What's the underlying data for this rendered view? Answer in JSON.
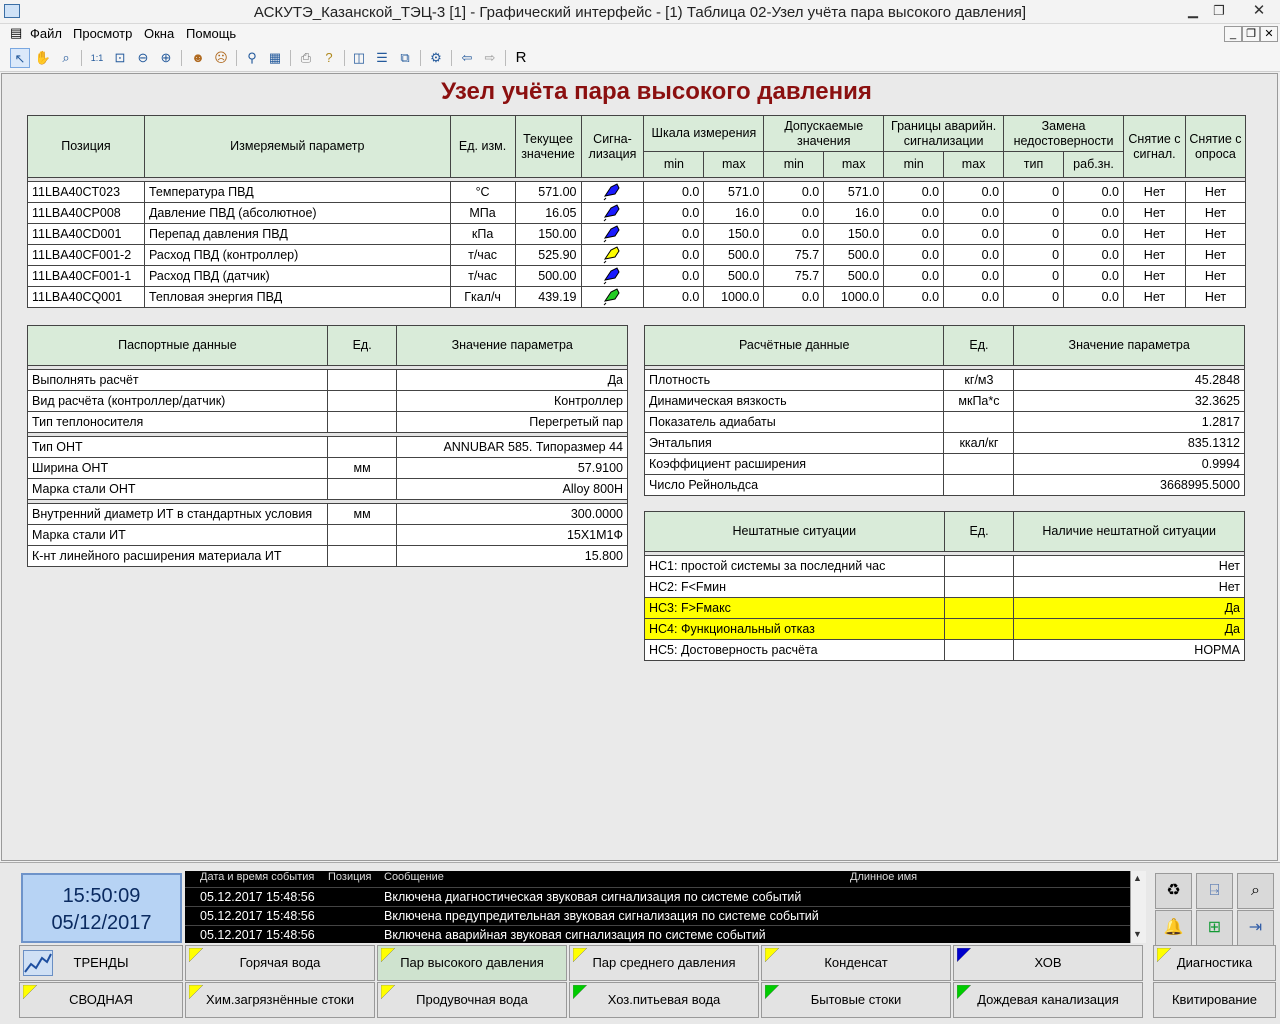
{
  "window": {
    "title": "АСКУТЭ_Казанской_ТЭЦ-3 [1] - Графический интерфейс - [1) Таблица 02-Узел учёта пара высокого давления]"
  },
  "menu": [
    "Файл",
    "Просмотр",
    "Окна",
    "Помощь"
  ],
  "toolbar": {
    "r_label": "R"
  },
  "page_title": "Узел учёта пара высокого давления",
  "main_table": {
    "headers": {
      "position": "Позиция",
      "parameter": "Измеряемый параметр",
      "unit": "Ед. изм.",
      "current": "Текущее значение",
      "signal": "Сигна-лизация",
      "scale": "Шкала измерения",
      "allowed": "Допускаемые значения",
      "emergency": "Границы аварийн. сигнализации",
      "replace": "Замена недостоверности",
      "remove_sig": "Снятие с сигнал.",
      "remove_poll": "Снятие с опроса",
      "min": "min",
      "max": "max",
      "type": "тип",
      "work": "раб.зн."
    },
    "rows": [
      {
        "pos": "11LBA40CT023",
        "name": "Температура ПВД",
        "unit": "°С",
        "value": "571.00",
        "signal_color": "#1a1aff",
        "smin": "0.0",
        "smax": "571.0",
        "amin": "0.0",
        "amax": "571.0",
        "emin": "0.0",
        "emax": "0.0",
        "rtype": "0",
        "rval": "0.0",
        "rsig": "Нет",
        "rpoll": "Нет"
      },
      {
        "pos": "11LBA40CP008",
        "name": "Давление ПВД (абсолютное)",
        "unit": "МПа",
        "value": "16.05",
        "signal_color": "#1a1aff",
        "smin": "0.0",
        "smax": "16.0",
        "amin": "0.0",
        "amax": "16.0",
        "emin": "0.0",
        "emax": "0.0",
        "rtype": "0",
        "rval": "0.0",
        "rsig": "Нет",
        "rpoll": "Нет"
      },
      {
        "pos": "11LBA40CD001",
        "name": "Перепад давления ПВД",
        "unit": "кПа",
        "value": "150.00",
        "signal_color": "#1a1aff",
        "smin": "0.0",
        "smax": "150.0",
        "amin": "0.0",
        "amax": "150.0",
        "emin": "0.0",
        "emax": "0.0",
        "rtype": "0",
        "rval": "0.0",
        "rsig": "Нет",
        "rpoll": "Нет"
      },
      {
        "pos": "11LBA40CF001-2",
        "name": "Расход ПВД (контроллер)",
        "unit": "т/час",
        "value": "525.90",
        "signal_color": "#ffff00",
        "smin": "0.0",
        "smax": "500.0",
        "amin": "75.7",
        "amax": "500.0",
        "emin": "0.0",
        "emax": "0.0",
        "rtype": "0",
        "rval": "0.0",
        "rsig": "Нет",
        "rpoll": "Нет"
      },
      {
        "pos": "11LBA40CF001-1",
        "name": "Расход ПВД (датчик)",
        "unit": "т/час",
        "value": "500.00",
        "signal_color": "#1a1aff",
        "smin": "0.0",
        "smax": "500.0",
        "amin": "75.7",
        "amax": "500.0",
        "emin": "0.0",
        "emax": "0.0",
        "rtype": "0",
        "rval": "0.0",
        "rsig": "Нет",
        "rpoll": "Нет"
      },
      {
        "pos": "11LBA40CQ001",
        "name": "Тепловая энергия ПВД",
        "unit": "Гкал/ч",
        "value": "439.19",
        "signal_color": "#22cc22",
        "smin": "0.0",
        "smax": "1000.0",
        "amin": "0.0",
        "amax": "1000.0",
        "emin": "0.0",
        "emax": "0.0",
        "rtype": "0",
        "rval": "0.0",
        "rsig": "Нет",
        "rpoll": "Нет"
      }
    ]
  },
  "passport": {
    "headers": {
      "name": "Паспортные данные",
      "unit": "Ед.",
      "value": "Значение параметра"
    },
    "rows": [
      {
        "name": "Выполнять расчёт",
        "unit": "",
        "value": "Да"
      },
      {
        "name": "Вид расчёта (контроллер/датчик)",
        "unit": "",
        "value": "Контроллер"
      },
      {
        "name": "Тип теплоносителя",
        "unit": "",
        "value": "Перегретый пар"
      },
      {
        "name": "Тип ОНТ",
        "unit": "",
        "value": "ANNUBAR 585. Типоразмер 44"
      },
      {
        "name": "Ширина ОНТ",
        "unit": "мм",
        "value": "57.9100"
      },
      {
        "name": "Марка стали ОНТ",
        "unit": "",
        "value": "Alloy 800H"
      },
      {
        "name": "Внутренний диаметр ИТ в стандартных условия",
        "unit": "мм",
        "value": "300.0000"
      },
      {
        "name": "Марка стали ИТ",
        "unit": "",
        "value": "15Х1М1Ф"
      },
      {
        "name": "К-нт линейного расширения материала ИТ",
        "unit": "",
        "value": "15.800"
      }
    ]
  },
  "calc": {
    "headers": {
      "name": "Расчётные данные",
      "unit": "Ед.",
      "value": "Значение параметра"
    },
    "rows": [
      {
        "name": "Плотность",
        "unit": "кг/м3",
        "value": "45.2848"
      },
      {
        "name": "Динамическая вязкость",
        "unit": "мкПа*с",
        "value": "32.3625"
      },
      {
        "name": "Показатель адиабаты",
        "unit": "",
        "value": "1.2817"
      },
      {
        "name": "Энтальпия",
        "unit": "ккал/кг",
        "value": "835.1312"
      },
      {
        "name": "Коэффициент расширения",
        "unit": "",
        "value": "0.9994"
      },
      {
        "name": "Число Рейнольдса",
        "unit": "",
        "value": "3668995.5000"
      }
    ]
  },
  "abnormal": {
    "headers": {
      "name": "Нештатные ситуации",
      "unit": "Ед.",
      "value": "Наличие нештатной ситуации"
    },
    "rows": [
      {
        "name": "НС1: простой системы за последний час",
        "unit": "",
        "value": "Нет"
      },
      {
        "name": "НС2: F<Fмин",
        "unit": "",
        "value": "Нет"
      },
      {
        "name": "НС3: F>Fмакс",
        "unit": "",
        "value": "Да"
      },
      {
        "name": "НС4: Функциональный отказ",
        "unit": "",
        "value": "Да"
      },
      {
        "name": "НС5: Достоверность расчёта",
        "unit": "",
        "value": "НОРМА"
      }
    ]
  },
  "clock": {
    "time": "15:50:09",
    "date": "05/12/2017"
  },
  "events": {
    "headers": {
      "datetime": "Дата и время события",
      "position": "Позиция",
      "message": "Сообщение",
      "longname": "Длинное имя"
    },
    "rows": [
      {
        "datetime": "05.12.2017 15:48:56",
        "position": "",
        "message": "Включена диагностическая звуковая сигнализация по системе событий",
        "longname": ""
      },
      {
        "datetime": "05.12.2017 15:48:56",
        "position": "",
        "message": "Включена предупредительная звуковая сигнализация по системе событий",
        "longname": ""
      },
      {
        "datetime": "05.12.2017 15:48:56",
        "position": "",
        "message": "Включена аварийная звуковая сигнализация по системе событий",
        "longname": ""
      }
    ]
  },
  "nav": {
    "trends": "ТРЕНДЫ",
    "summary": "СВОДНАЯ",
    "row1": [
      {
        "label": "Горячая вода",
        "flag": "#ffff00"
      },
      {
        "label": "Пар высокого давления",
        "flag": "#ffff00"
      },
      {
        "label": "Пар среднего давления",
        "flag": "#ffff00"
      },
      {
        "label": "Конденсат",
        "flag": "#ffff00"
      },
      {
        "label": "ХОВ",
        "flag": "#0000cc"
      }
    ],
    "row2": [
      {
        "label": "Хим.загрязнённые стоки",
        "flag": "#ffff00"
      },
      {
        "label": "Продувочная вода",
        "flag": "#ffff00"
      },
      {
        "label": "Хоз.питьевая вода",
        "flag": "#00cc00"
      },
      {
        "label": "Бытовые стоки",
        "flag": "#00cc00"
      },
      {
        "label": "Дождевая канализация",
        "flag": "#00cc00"
      }
    ],
    "diagnostics": "Диагностика",
    "acknowledge": "Квитирование"
  },
  "colors": {
    "title": "#8b1010",
    "header_bg": "#d9ebd9",
    "alarm_row": "#ffff00",
    "clock_bg": "#b7d3f4"
  }
}
